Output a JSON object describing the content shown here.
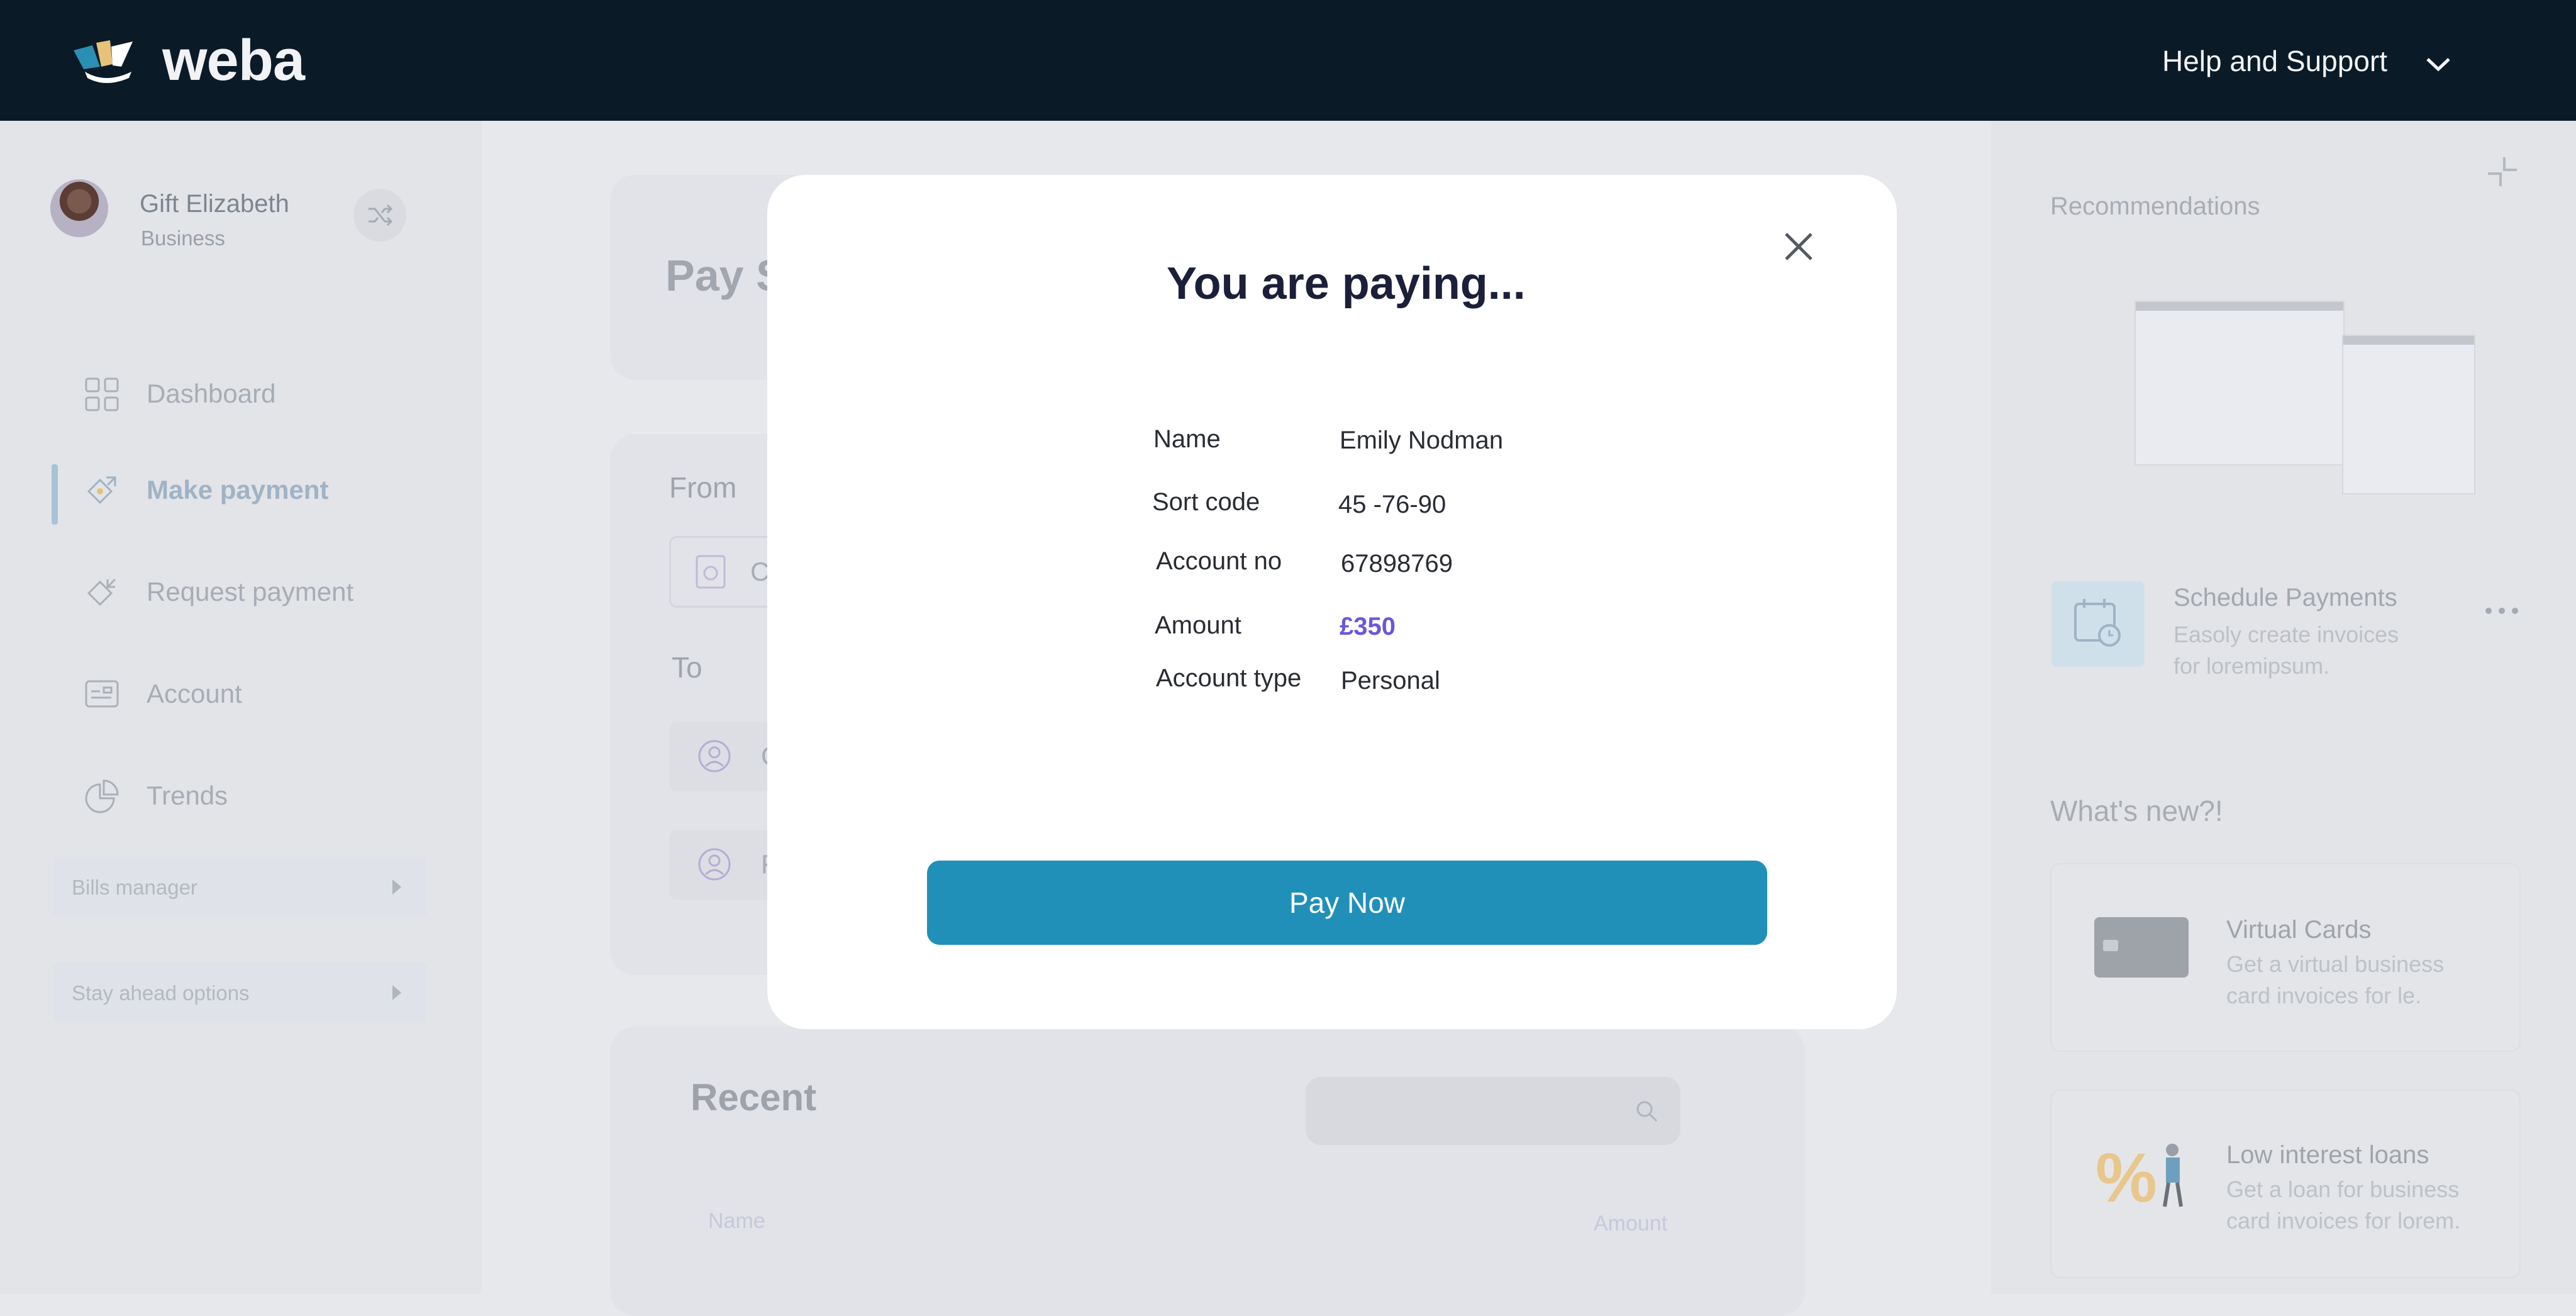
{
  "app": {
    "name": "weba"
  },
  "header": {
    "help_label": "Help and Support"
  },
  "user": {
    "name": "Gift Elizabeth",
    "role": "Business"
  },
  "sidebar": {
    "items": [
      {
        "label": "Dashboard",
        "icon": "grid-icon"
      },
      {
        "label": "Make payment",
        "icon": "payment-send-icon",
        "active": true
      },
      {
        "label": "Request payment",
        "icon": "payment-request-icon"
      },
      {
        "label": "Account",
        "icon": "account-card-icon"
      },
      {
        "label": "Trends",
        "icon": "pie-chart-icon"
      }
    ],
    "sections": [
      {
        "label": "Bills manager"
      },
      {
        "label": "Stay ahead options"
      }
    ]
  },
  "main": {
    "title_partial": "Pay S",
    "from_label": "From",
    "from_value_partial": "C",
    "to_label": "To",
    "to_rows": [
      {
        "text_partial": "C"
      },
      {
        "text_partial": "F"
      }
    ],
    "recent": {
      "title": "Recent",
      "col_name": "Name",
      "col_amount": "Amount"
    }
  },
  "right_panel": {
    "recommendations_title": "Recommendations",
    "schedule": {
      "title": "Schedule Payments",
      "desc_line1": "Easoly create invoices",
      "desc_line2": "for loremipsum."
    },
    "whats_new_title": "What's new?!",
    "features": [
      {
        "title": "Virtual Cards",
        "desc_line1": "Get a virtual business",
        "desc_line2": "card invoices for le."
      },
      {
        "title": "Low interest loans",
        "desc_line1": "Get a loan for  business",
        "desc_line2": "card invoices for lorem."
      }
    ]
  },
  "modal": {
    "title": "You are paying...",
    "details": [
      {
        "label": "Name",
        "value": "Emily Nodman"
      },
      {
        "label": "Sort code",
        "value": "45 -76-90"
      },
      {
        "label": "Account no",
        "value": "67898769"
      },
      {
        "label": "Amount",
        "value": "£350"
      },
      {
        "label": "Account type",
        "value": "Personal"
      }
    ],
    "pay_button": "Pay Now"
  },
  "colors": {
    "topbar": "#0b1a27",
    "primary_button": "#2190b9",
    "amount_accent": "#6f55d8",
    "modal_title": "#1c1f3a"
  }
}
